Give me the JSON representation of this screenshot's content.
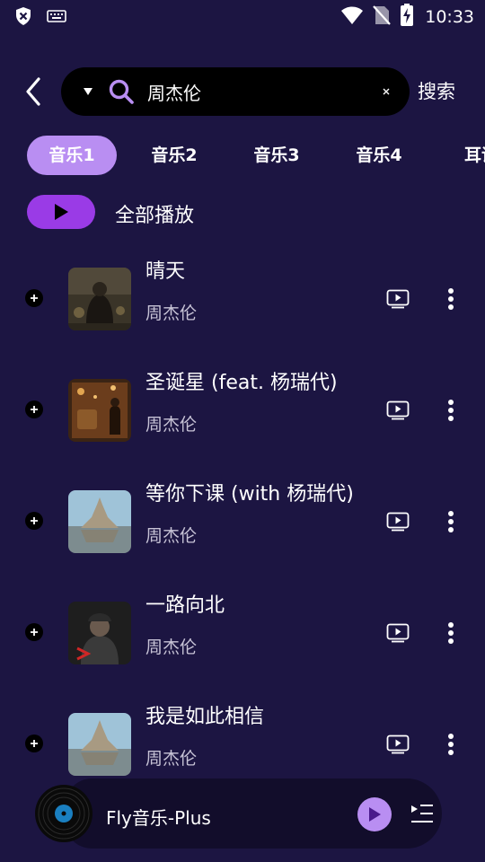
{
  "status_bar": {
    "time": "10:33",
    "left_icons": [
      "shield-icon",
      "keyboard-icon"
    ],
    "right_icons": [
      "wifi-icon",
      "no-sim-icon",
      "battery-charging-icon"
    ]
  },
  "header": {
    "back_icon": "chevron-left-icon",
    "search": {
      "dropdown_icon": "triangle-down-icon",
      "search_icon": "magnifier-icon",
      "value": "周杰伦",
      "clear_icon": "close-icon"
    },
    "search_button_label": "搜索"
  },
  "tabs": [
    {
      "label": "音乐1",
      "active": true
    },
    {
      "label": "音乐2",
      "active": false
    },
    {
      "label": "音乐3",
      "active": false
    },
    {
      "label": "音乐4",
      "active": false
    },
    {
      "label": "耳语",
      "active": false
    }
  ],
  "play_all": {
    "label": "全部播放",
    "icon": "play-icon"
  },
  "songs": [
    {
      "title": "晴天",
      "artist": "周杰伦"
    },
    {
      "title": "圣诞星 (feat. 杨瑞代)",
      "artist": "周杰伦"
    },
    {
      "title": "等你下课 (with 杨瑞代)",
      "artist": "周杰伦"
    },
    {
      "title": "一路向北",
      "artist": "周杰伦"
    },
    {
      "title": "我是如此相信",
      "artist": "周杰伦"
    }
  ],
  "player": {
    "title": "Fly音乐-Plus",
    "play_icon": "play-icon",
    "queue_icon": "playlist-icon"
  },
  "colors": {
    "background": "#1c1542",
    "accent": "#b98ef2",
    "play_all": "#9a3be6",
    "search_bg": "#000000"
  }
}
